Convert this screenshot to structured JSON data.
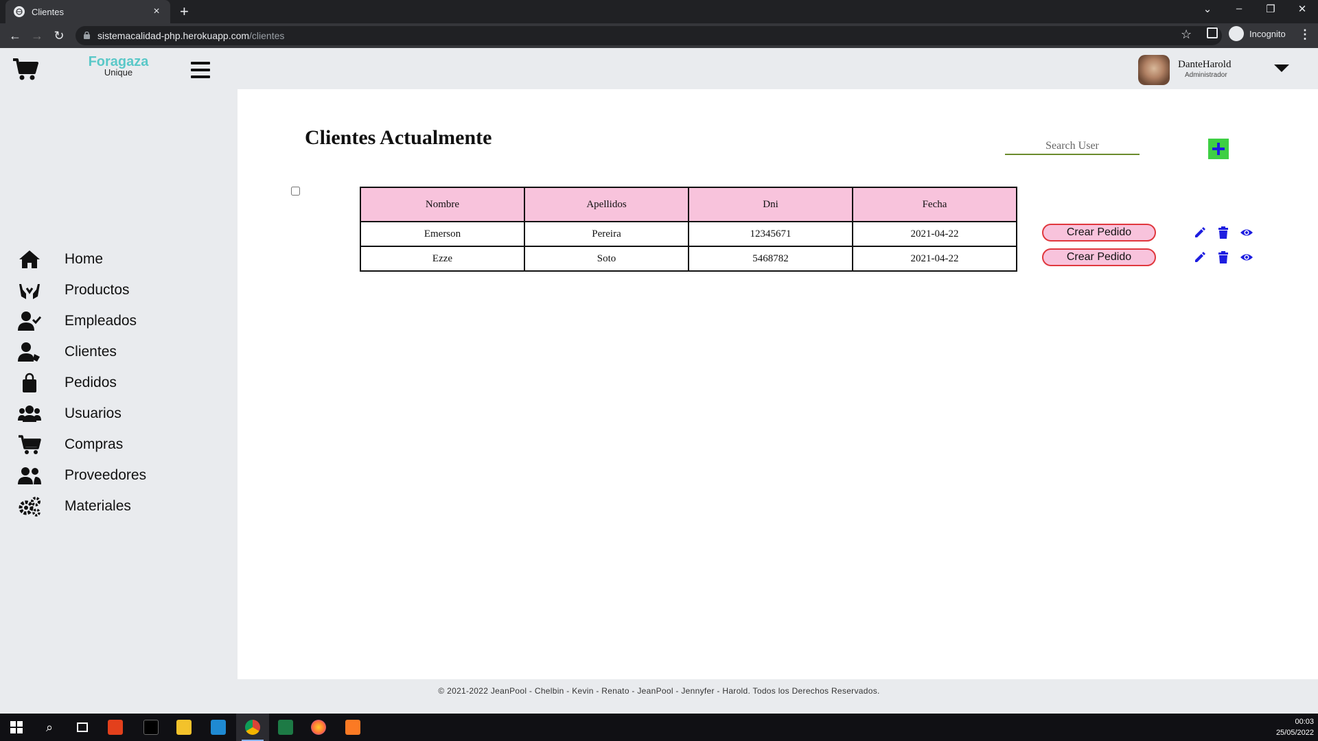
{
  "browser": {
    "tab_title": "Clientes",
    "url_host": "sistemacalidad-php.herokuapp.com",
    "url_path": "/clientes",
    "incognito_label": "Incognito"
  },
  "brand": {
    "name": "Foragaza",
    "sub": "Unique"
  },
  "user": {
    "name": "DanteHarold",
    "role": "Administrador"
  },
  "sidebar": {
    "items": [
      {
        "label": "Home",
        "icon": "home-icon"
      },
      {
        "label": "Productos",
        "icon": "hands-icon"
      },
      {
        "label": "Empleados",
        "icon": "user-check-icon"
      },
      {
        "label": "Clientes",
        "icon": "user-tag-icon"
      },
      {
        "label": "Pedidos",
        "icon": "shopping-bag-icon"
      },
      {
        "label": "Usuarios",
        "icon": "users-icon"
      },
      {
        "label": "Compras",
        "icon": "cart-icon"
      },
      {
        "label": "Proveedores",
        "icon": "user-friends-icon"
      },
      {
        "label": "Materiales",
        "icon": "cogs-icon"
      }
    ]
  },
  "main": {
    "title": "Clientes Actualmente",
    "search_placeholder": "Search User",
    "table": {
      "headers": [
        "Nombre",
        "Apellidos",
        "Dni",
        "Fecha"
      ],
      "rows": [
        {
          "nombre": "Emerson",
          "apellidos": "Pereira",
          "dni": "12345671",
          "fecha": "2021-04-22",
          "action": "Crear Pedido"
        },
        {
          "nombre": "Ezze",
          "apellidos": "Soto",
          "dni": "5468782",
          "fecha": "2021-04-22",
          "action": "Crear Pedido"
        }
      ]
    }
  },
  "footer": {
    "text": "© 2021-2022 JeanPool - Chelbin - Kevin - Renato - JeanPool - Jennyfer - Harold. Todos los Derechos Reservados."
  },
  "taskbar": {
    "time": "00:03",
    "date": "25/05/2022"
  },
  "colors": {
    "accent_brand": "#5ac8c8",
    "table_header": "#f8c3dc",
    "add_button": "#3ecf44",
    "action_icons": "#1d1de0",
    "crear_border": "#e0383e"
  }
}
